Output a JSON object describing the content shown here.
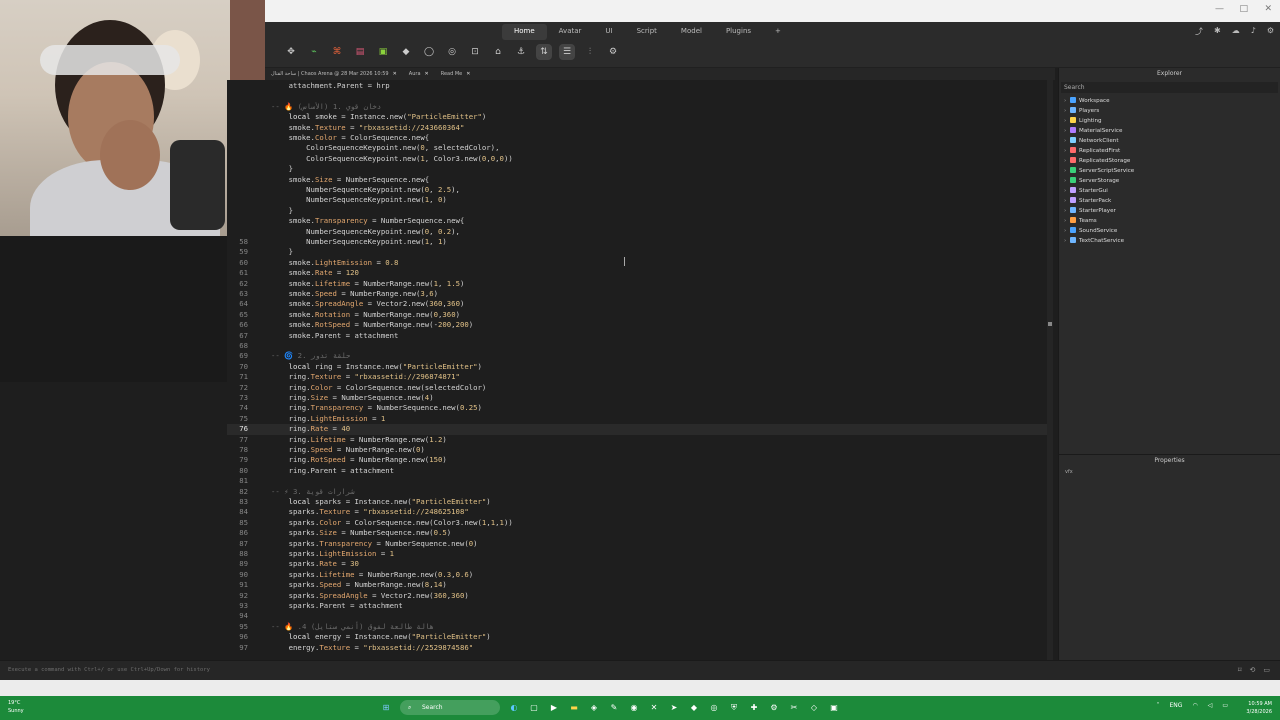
{
  "ribbon": {
    "tabs": [
      "Home",
      "Avatar",
      "UI",
      "Script",
      "Model",
      "Plugins",
      "+"
    ],
    "active_tab": "Home",
    "right_icons": [
      "share-icon",
      "tools-icon",
      "cloud-icon",
      "bell-icon",
      "settings-icon"
    ]
  },
  "doc_tabs": [
    {
      "label": "ساحة القتال | Chaos Arena @ 28 Mar 2026 10:59"
    },
    {
      "label": "Aura"
    },
    {
      "label": "Read Me"
    }
  ],
  "code_lines": [
    {
      "n": "",
      "t": "        attachment.Parent = hrp"
    },
    {
      "n": "",
      "t": ""
    },
    {
      "n": "",
      "t": "    -- 🔥 (الأساس) دخان قوي .1"
    },
    {
      "n": "",
      "t": "        local smoke = Instance.new(\"ParticleEmitter\")"
    },
    {
      "n": "",
      "t": "        smoke.Texture = \"rbxassetid://243660364\""
    },
    {
      "n": "",
      "t": "        smoke.Color = ColorSequence.new{"
    },
    {
      "n": "",
      "t": "            ColorSequenceKeypoint.new(0, selectedColor),"
    },
    {
      "n": "",
      "t": "            ColorSequenceKeypoint.new(1, Color3.new(0,0,0))"
    },
    {
      "n": "",
      "t": "        }"
    },
    {
      "n": "",
      "t": "        smoke.Size = NumberSequence.new{"
    },
    {
      "n": "",
      "t": "            NumberSequenceKeypoint.new(0, 2.5),"
    },
    {
      "n": "",
      "t": "            NumberSequenceKeypoint.new(1, 0)"
    },
    {
      "n": "",
      "t": "        }"
    },
    {
      "n": "",
      "t": "        smoke.Transparency = NumberSequence.new{"
    },
    {
      "n": "",
      "t": "            NumberSequenceKeypoint.new(0, 0.2),"
    },
    {
      "n": "58",
      "t": "            NumberSequenceKeypoint.new(1, 1)"
    },
    {
      "n": "59",
      "t": "        }"
    },
    {
      "n": "60",
      "t": "        smoke.LightEmission = 0.8"
    },
    {
      "n": "61",
      "t": "        smoke.Rate = 120"
    },
    {
      "n": "62",
      "t": "        smoke.Lifetime = NumberRange.new(1, 1.5)"
    },
    {
      "n": "63",
      "t": "        smoke.Speed = NumberRange.new(3,6)"
    },
    {
      "n": "64",
      "t": "        smoke.SpreadAngle = Vector2.new(360,360)"
    },
    {
      "n": "65",
      "t": "        smoke.Rotation = NumberRange.new(0,360)"
    },
    {
      "n": "66",
      "t": "        smoke.RotSpeed = NumberRange.new(-200,200)"
    },
    {
      "n": "67",
      "t": "        smoke.Parent = attachment"
    },
    {
      "n": "68",
      "t": ""
    },
    {
      "n": "69",
      "t": "    -- 🌀 حلقة تدور .2"
    },
    {
      "n": "70",
      "t": "        local ring = Instance.new(\"ParticleEmitter\")"
    },
    {
      "n": "71",
      "t": "        ring.Texture = \"rbxassetid://296874871\""
    },
    {
      "n": "72",
      "t": "        ring.Color = ColorSequence.new(selectedColor)"
    },
    {
      "n": "73",
      "t": "        ring.Size = NumberSequence.new(4)"
    },
    {
      "n": "74",
      "t": "        ring.Transparency = NumberSequence.new(0.25)"
    },
    {
      "n": "75",
      "t": "        ring.LightEmission = 1"
    },
    {
      "n": "76",
      "t": "        ring.Rate = 40"
    },
    {
      "n": "77",
      "t": "        ring.Lifetime = NumberRange.new(1.2)"
    },
    {
      "n": "78",
      "t": "        ring.Speed = NumberRange.new(0)"
    },
    {
      "n": "79",
      "t": "        ring.RotSpeed = NumberRange.new(150)"
    },
    {
      "n": "80",
      "t": "        ring.Parent = attachment"
    },
    {
      "n": "81",
      "t": ""
    },
    {
      "n": "82",
      "t": "    -- ⚡ شرارات قوية .3"
    },
    {
      "n": "83",
      "t": "        local sparks = Instance.new(\"ParticleEmitter\")"
    },
    {
      "n": "84",
      "t": "        sparks.Texture = \"rbxassetid://248625108\""
    },
    {
      "n": "85",
      "t": "        sparks.Color = ColorSequence.new(Color3.new(1,1,1))"
    },
    {
      "n": "86",
      "t": "        sparks.Size = NumberSequence.new(0.5)"
    },
    {
      "n": "87",
      "t": "        sparks.Transparency = NumberSequence.new(0)"
    },
    {
      "n": "88",
      "t": "        sparks.LightEmission = 1"
    },
    {
      "n": "89",
      "t": "        sparks.Rate = 30"
    },
    {
      "n": "90",
      "t": "        sparks.Lifetime = NumberRange.new(0.3,0.6)"
    },
    {
      "n": "91",
      "t": "        sparks.Speed = NumberRange.new(8,14)"
    },
    {
      "n": "92",
      "t": "        sparks.SpreadAngle = Vector2.new(360,360)"
    },
    {
      "n": "93",
      "t": "        sparks.Parent = attachment"
    },
    {
      "n": "94",
      "t": ""
    },
    {
      "n": "95",
      "t": "    -- 🔥 .4 هالة طالعة لفوق (أنمي ستايل)"
    },
    {
      "n": "96",
      "t": "        local energy = Instance.new(\"ParticleEmitter\")"
    },
    {
      "n": "97",
      "t": "        energy.Texture = \"rbxassetid://2529874586\""
    }
  ],
  "current_line": "76",
  "explorer": {
    "title": "Explorer",
    "search_placeholder": "Search",
    "services": [
      {
        "name": "Workspace",
        "color": "#4aa3ff"
      },
      {
        "name": "Players",
        "color": "#6fb6ff"
      },
      {
        "name": "Lighting",
        "color": "#ffd54a"
      },
      {
        "name": "MaterialService",
        "color": "#b07cff"
      },
      {
        "name": "NetworkClient",
        "color": "#7fd0ff"
      },
      {
        "name": "ReplicatedFirst",
        "color": "#ff6b6b"
      },
      {
        "name": "ReplicatedStorage",
        "color": "#ff6b6b"
      },
      {
        "name": "ServerScriptService",
        "color": "#3ad07a"
      },
      {
        "name": "ServerStorage",
        "color": "#3ad07a"
      },
      {
        "name": "StarterGui",
        "color": "#c0a0ff"
      },
      {
        "name": "StarterPack",
        "color": "#c0a0ff"
      },
      {
        "name": "StarterPlayer",
        "color": "#6fb6ff"
      },
      {
        "name": "Teams",
        "color": "#ff9f43"
      },
      {
        "name": "SoundService",
        "color": "#4aa3ff"
      },
      {
        "name": "TextChatService",
        "color": "#6fb6ff"
      }
    ]
  },
  "properties": {
    "title": "Properties",
    "filter_hint": "vfx"
  },
  "command_bar": {
    "placeholder": "Execute a command with Ctrl+/ or use Ctrl+Up/Down for history"
  },
  "taskbar": {
    "weather_temp": "19°C",
    "weather_desc": "Sunny",
    "search_label": "Search",
    "tray_lang": "ENG",
    "time": "10:59 AM",
    "date": "3/28/2026"
  }
}
